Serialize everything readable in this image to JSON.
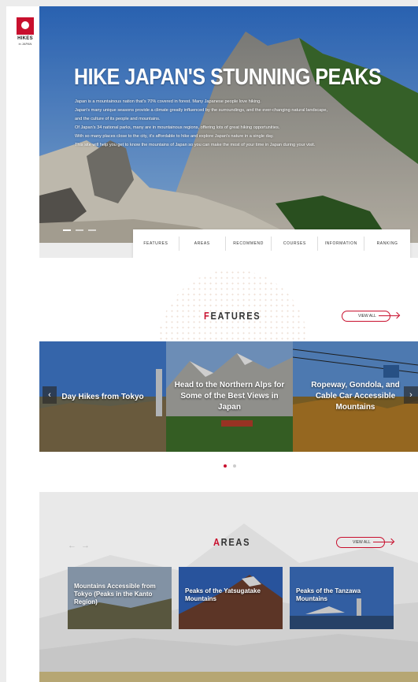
{
  "brand": {
    "name": "HIKES",
    "sub": "in JAPAN",
    "accent": "#c8102e"
  },
  "hero": {
    "title": "HIKE JAPAN'S STUNNING PEAKS",
    "paragraphs": [
      "Japan is a mountainous nation that's 70% covered in forest. Many Japanese people love hiking.",
      "Japan's many unique seasons provide a climate greatly influenced by the surroundings, and the ever-changing natural landscape,",
      "and the culture of its people and mountains.",
      "Of Japan's 34 national parks, many are in mountainous regions, offering lots of great hiking opportunities.",
      "With so many places close to the city, it's affordable to hike and explore Japan's nature in a single day.",
      "This site will help you get to know the mountains of Japan so you can make the most of your time in Japan during your visit."
    ]
  },
  "nav": [
    "FEATURES",
    "AREAS",
    "RECOMMEND",
    "COURSES",
    "INFORMATION",
    "RANKING"
  ],
  "features": {
    "title_first": "F",
    "title_rest": "EATURES",
    "view_all": "VIEW ALL",
    "prev": "‹",
    "next": "›",
    "cards": [
      {
        "label": "Day Hikes from Tokyo"
      },
      {
        "label": "Head to the Northern Alps for Some of the Best Views in Japan"
      },
      {
        "label": "Ropeway, Gondola, and Cable Car Accessible Mountains"
      }
    ]
  },
  "areas": {
    "title_first": "A",
    "title_rest": "REAS",
    "view_all": "VIEW ALL",
    "prev": "←",
    "next": "→",
    "cards": [
      {
        "label": "Mountains Accessible from Tokyo (Peaks in the Kanto Region)"
      },
      {
        "label": "Peaks of the Yatsugatake Mountains"
      },
      {
        "label": "Peaks of the Tanzawa Mountains"
      }
    ]
  }
}
